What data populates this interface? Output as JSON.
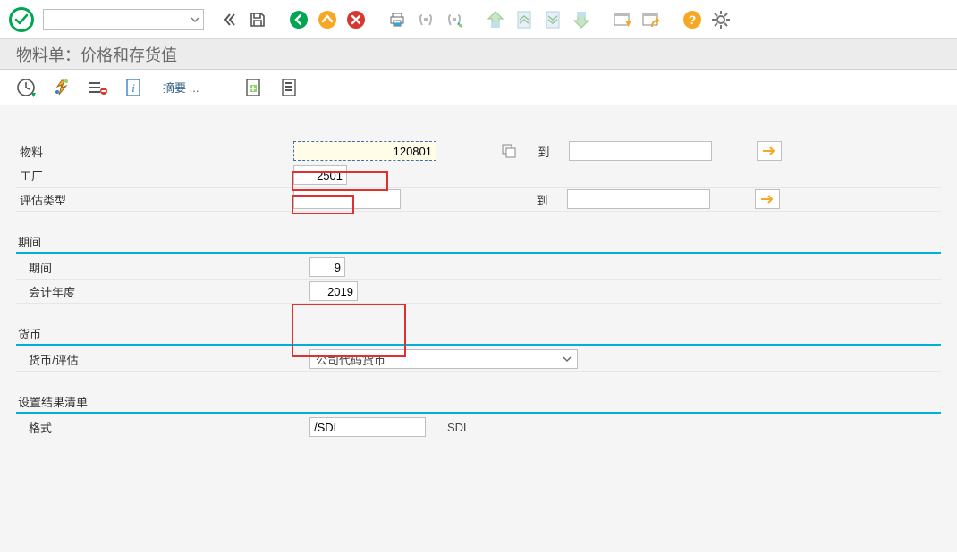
{
  "title": "物料单：价格和存货值",
  "sel": {
    "material_label": "物料",
    "material_value": "120801",
    "plant_label": "工厂",
    "plant_value": "2501",
    "valtype_label": "评估类型",
    "valtype_value": "",
    "to": "到",
    "to_value1": "",
    "to_value2": ""
  },
  "period_group": {
    "title": "期间",
    "period_label": "期间",
    "period_value": "9",
    "year_label": "会计年度",
    "year_value": "2019"
  },
  "currency_group": {
    "title": "货币",
    "field_label": "货币/评估",
    "option": "公司代码货币"
  },
  "result_group": {
    "title": "设置结果清单",
    "format_label": "格式",
    "format_value": "/SDL",
    "format_text": "SDL"
  },
  "secondary": {
    "summary": "摘要 ..."
  }
}
